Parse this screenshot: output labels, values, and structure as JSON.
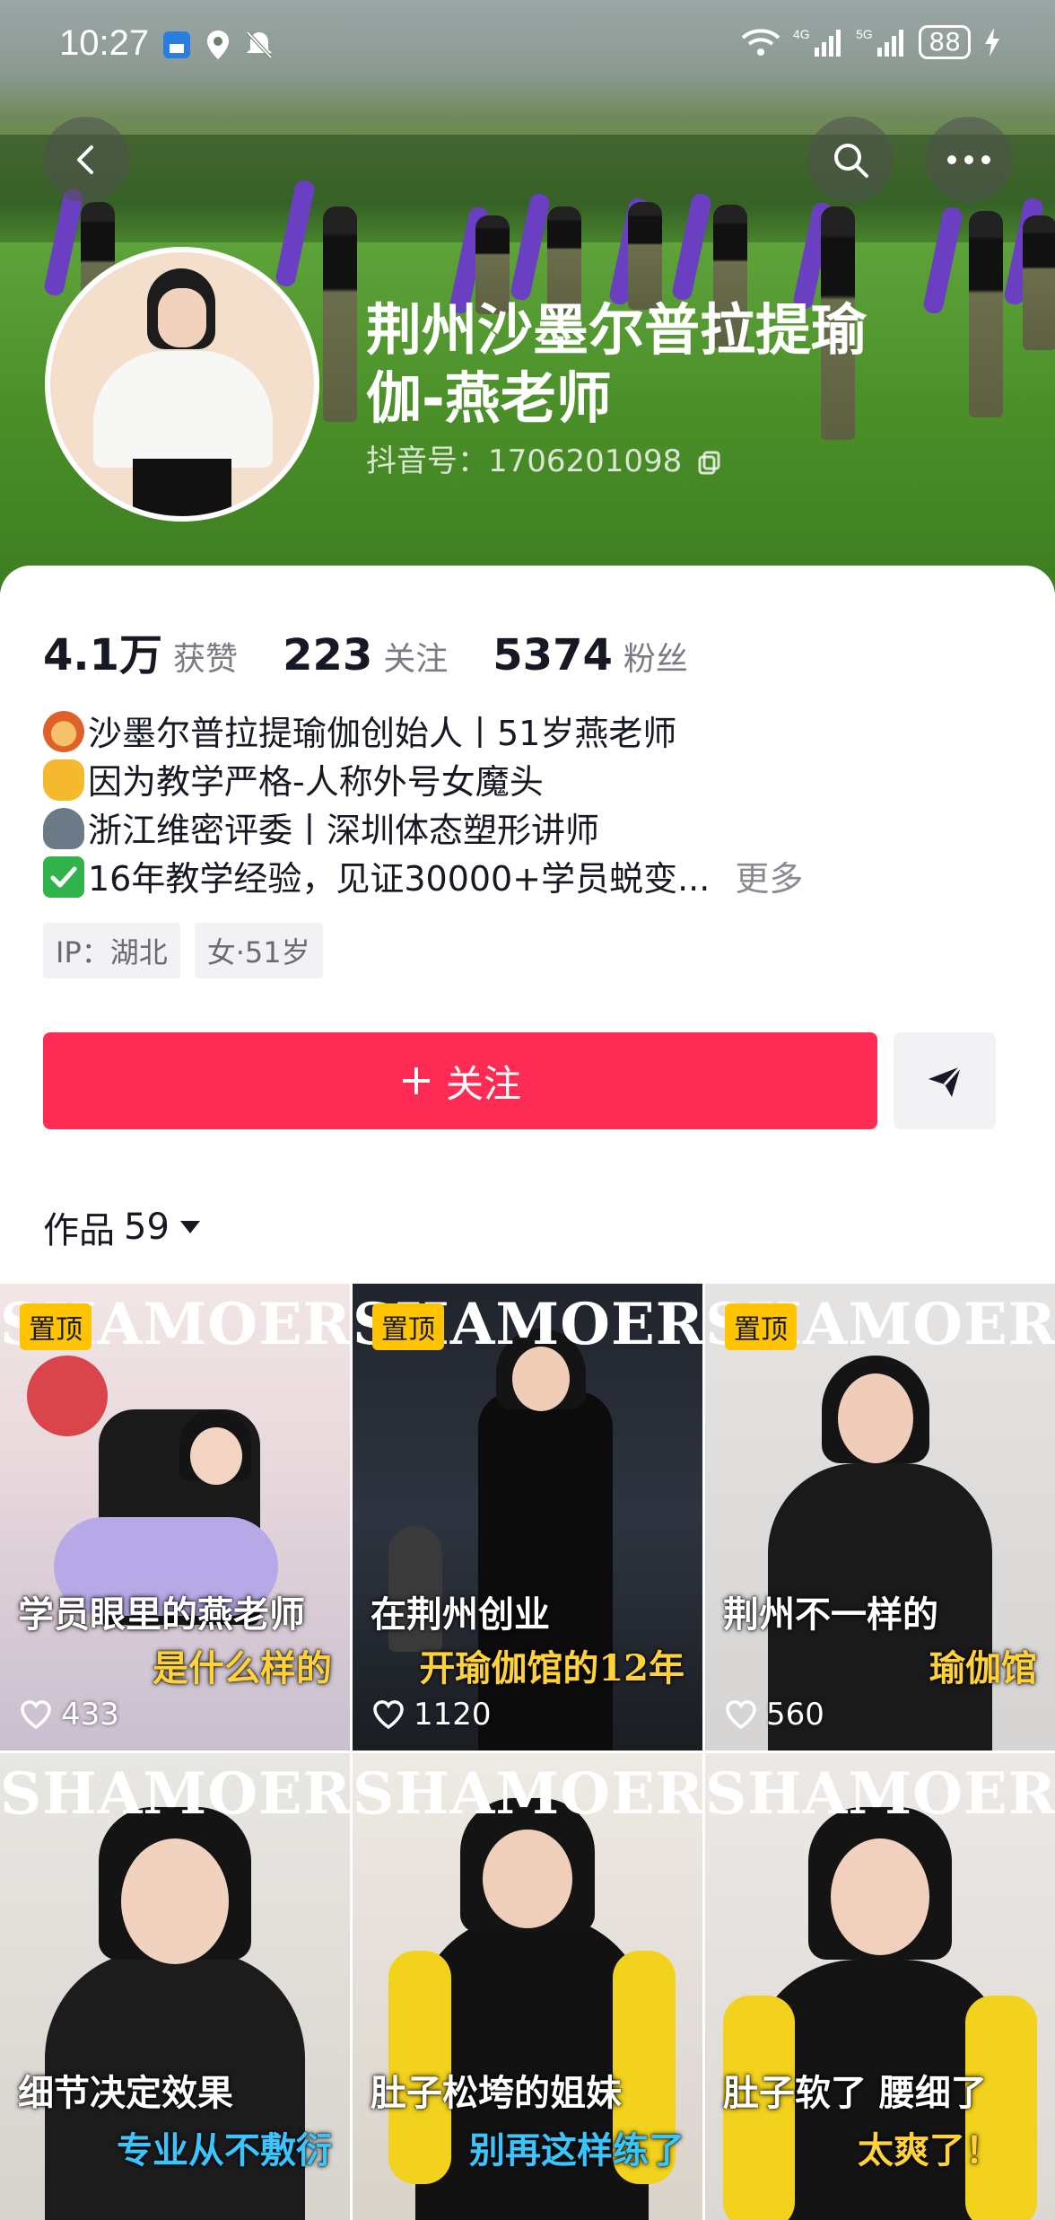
{
  "status_bar": {
    "time": "10:27",
    "network": "4G 5G",
    "battery": "88"
  },
  "profile": {
    "name": "荆州沙墨尔普拉提瑜伽-燕老师",
    "douyin_id_label": "抖音号：",
    "douyin_id": "1706201098"
  },
  "stats": [
    {
      "num": "4.1万",
      "label": "获赞"
    },
    {
      "num": "223",
      "label": "关注"
    },
    {
      "num": "5374",
      "label": "粉丝"
    }
  ],
  "bio": [
    {
      "icon": "woman-emoji-icon",
      "text": "沙墨尔普拉提瑜伽创始人丨51岁燕老师"
    },
    {
      "icon": "raised-fist-emoji-icon",
      "text": "因为教学严格-人称外号女魔头"
    },
    {
      "icon": "speaking-head-emoji-icon",
      "text": "浙江维密评委丨深圳体态塑形讲师"
    },
    {
      "icon": "check-mark-emoji-icon",
      "text": "16年教学经验，见证30000+学员蜕变..."
    }
  ],
  "bio_more": "更多",
  "tags": [
    "IP：湖北",
    "女·51岁"
  ],
  "follow_button": "关注",
  "works": {
    "label": "作品",
    "count": "59"
  },
  "pin_label": "置顶",
  "brand": "SHAMOER",
  "videos": [
    {
      "caption1": "学员眼里的燕老师",
      "caption2": "是什么样的",
      "likes": "433",
      "pinned": true
    },
    {
      "caption1": "在荆州创业",
      "caption2": "开瑜伽馆的12年",
      "likes": "1120",
      "pinned": true
    },
    {
      "caption1": "荆州不一样的",
      "caption2": "瑜伽馆",
      "likes": "560",
      "pinned": true
    },
    {
      "caption1": "细节决定效果",
      "caption2": "专业从不敷衍",
      "likes": "",
      "pinned": false
    },
    {
      "caption1": "肚子松垮的姐妹",
      "caption2": "别再这样练了",
      "likes": "",
      "pinned": false
    },
    {
      "caption1": "肚子软了 腰细了",
      "caption2": "太爽了！",
      "likes": "",
      "pinned": false
    }
  ],
  "colors": {
    "accent": "#fe2c55",
    "pin": "#ffc300",
    "text": "#161823",
    "muted": "#7a7a82"
  }
}
